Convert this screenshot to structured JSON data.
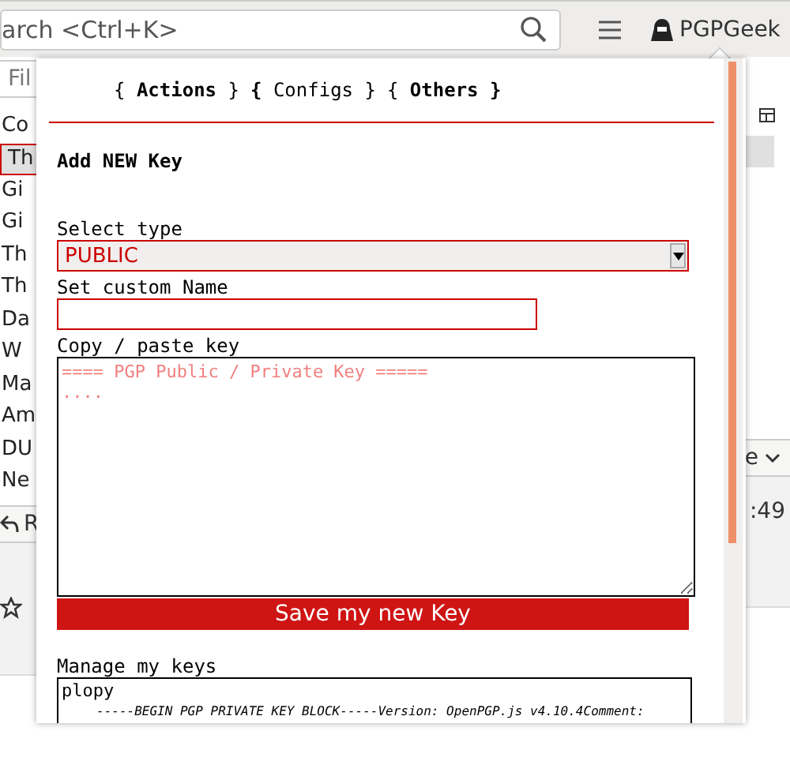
{
  "toolbar": {
    "search_placeholder": "arch <Ctrl+K>",
    "account": "PGPGeek"
  },
  "filter": {
    "placeholder": "Fil"
  },
  "message_list": {
    "header": "Co",
    "rows": [
      {
        "text": "Th",
        "selected": true
      },
      {
        "text": "Gi",
        "selected": false
      },
      {
        "text": "Gi",
        "selected": false
      },
      {
        "text": "Th",
        "selected": false
      },
      {
        "text": "Th",
        "selected": false
      },
      {
        "text": "Da",
        "selected": false
      },
      {
        "text": "W",
        "selected": false
      },
      {
        "text": "Ma",
        "selected": false
      },
      {
        "text": "Am",
        "selected": false
      },
      {
        "text": "DU",
        "selected": false
      },
      {
        "text": "Ne",
        "selected": false
      }
    ]
  },
  "message_toolbar": {
    "reply": "R",
    "more": "e"
  },
  "message_header": {
    "time": ":49"
  },
  "popup": {
    "tabs": [
      {
        "label": "{ **Actions** }"
      },
      {
        "label": "**{** Configs }"
      },
      {
        "label": "{ **Others }**"
      }
    ],
    "heading": "Add NEW Key",
    "select_label": "Select type",
    "select_value": "PUBLIC",
    "name_label": "Set custom Name",
    "key_label": "Copy / paste key",
    "key_placeholder": "==== PGP Public / Private Key =====\n....",
    "save_button": "Save my new Key",
    "manage_label": "Manage my keys",
    "keys": [
      {
        "name": "plopy",
        "preview": "-----BEGIN PGP PRIVATE KEY BLOCK-----Version: OpenPGP.js v4.10.4Comment:"
      }
    ]
  }
}
